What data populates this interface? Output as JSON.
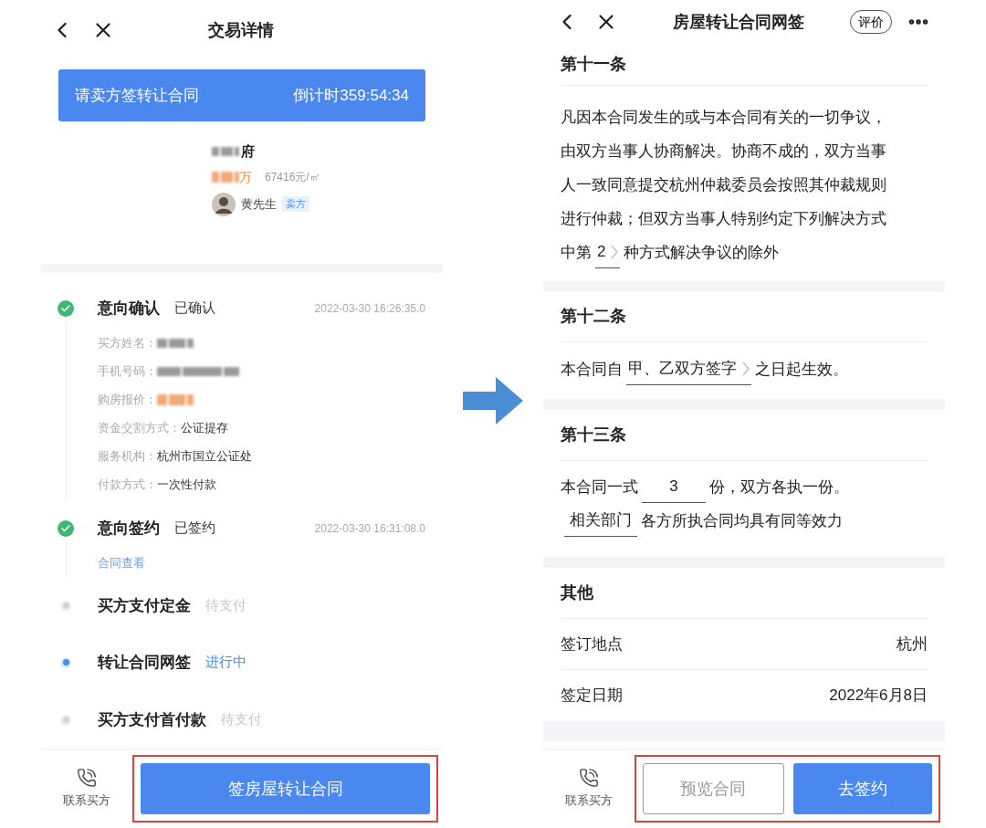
{
  "left_screen": {
    "header": {
      "title": "交易详情"
    },
    "banner": {
      "message": "请卖方签转让合同",
      "countdown": "倒计时359:54:34"
    },
    "property": {
      "name_suffix": "府",
      "price_suffix": "万",
      "unit_price": "67416元/㎡",
      "agent": "黄先生",
      "role_badge": "卖方"
    },
    "steps": [
      {
        "title": "意向确认",
        "status": "已确认",
        "kind": "done",
        "time": "2022-03-30 16:26:35.0",
        "fields": [
          {
            "label": "买方姓名：",
            "blurred": true
          },
          {
            "label": "手机号码：",
            "blurred": true
          },
          {
            "label": "购房报价：",
            "blurred": true
          },
          {
            "label": "资金交割方式：",
            "value": "公证提存",
            "blurred": false
          },
          {
            "label": "服务机构：",
            "value": "杭州市国立公证处",
            "blurred": false
          },
          {
            "label": "付款方式：",
            "value": "一次性付款",
            "blurred": false
          }
        ]
      },
      {
        "title": "意向签约",
        "status": "已签约",
        "kind": "done",
        "time": "2022-03-30 16:31:08.0",
        "link": "合同查看"
      },
      {
        "title": "买方支付定金",
        "status": "待支付",
        "kind": "pending"
      },
      {
        "title": "转让合同网签",
        "status": "进行中",
        "kind": "active"
      },
      {
        "title": "买方支付首付款",
        "status": "待支付",
        "kind": "pending"
      }
    ],
    "bottom_bar": {
      "contact": "联系买方",
      "highlighted": true,
      "buttons": [
        {
          "label": "签房屋转让合同",
          "kind": "primary"
        }
      ]
    }
  },
  "right_screen": {
    "header": {
      "title": "房屋转让合同网签",
      "rate": "评价"
    },
    "sections": [
      {
        "title": "第十一条",
        "lines": [
          [
            {
              "kind": "text",
              "text": "凡因本合同发生的或与本合同有关的一切争议，"
            }
          ],
          [
            {
              "kind": "text",
              "text": "由双方当事人协商解决。协商不成的，双方当事"
            }
          ],
          [
            {
              "kind": "text",
              "text": "人一致同意提交杭州仲裁委员会按照其仲裁规则"
            }
          ],
          [
            {
              "kind": "text",
              "text": "进行仲裁；但双方当事人特别约定下列解决方式"
            }
          ],
          [
            {
              "kind": "text",
              "text": "中第"
            },
            {
              "kind": "select",
              "value": "2"
            },
            {
              "kind": "text",
              "text": "种方式解决争议的除外"
            }
          ]
        ]
      },
      {
        "title": "第十二条",
        "lines": [
          [
            {
              "kind": "text",
              "text": "本合同自"
            },
            {
              "kind": "select",
              "value": "甲、乙双方签字"
            },
            {
              "kind": "text",
              "text": "之日起生效。"
            }
          ]
        ]
      },
      {
        "title": "第十三条",
        "lines": [
          [
            {
              "kind": "text",
              "text": "本合同一式"
            },
            {
              "kind": "input",
              "value": "3"
            },
            {
              "kind": "text",
              "text": "份，双方各执一份。"
            }
          ],
          [
            {
              "kind": "input",
              "value": "相关部门"
            },
            {
              "kind": "text",
              "text": "各方所执合同均具有同等效力"
            }
          ]
        ]
      },
      {
        "title": "其他",
        "rows": [
          {
            "label": "签订地点",
            "value": "杭州"
          },
          {
            "label": "签定日期",
            "value": "2022年6月8日"
          }
        ]
      }
    ],
    "bottom_bar": {
      "contact": "联系买方",
      "highlighted": true,
      "buttons": [
        {
          "label": "预览合同",
          "kind": "outline"
        },
        {
          "label": "去签约",
          "kind": "primary"
        }
      ]
    }
  }
}
